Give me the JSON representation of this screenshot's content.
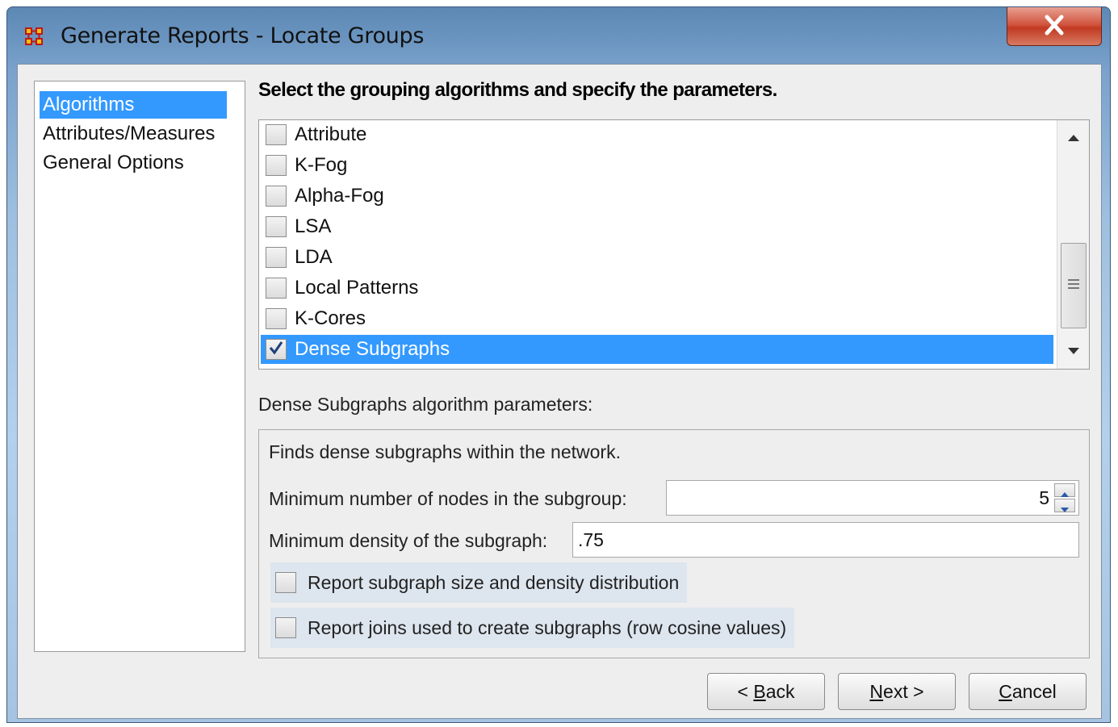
{
  "window": {
    "title": "Generate Reports - Locate Groups",
    "close_label": "X"
  },
  "nav": {
    "items": [
      {
        "label": "Algorithms",
        "selected": true
      },
      {
        "label": "Attributes/Measures",
        "selected": false
      },
      {
        "label": "General Options",
        "selected": false
      }
    ]
  },
  "algorithms": {
    "heading": "Select the grouping algorithms and specify the parameters.",
    "items": [
      {
        "label": "Attribute",
        "checked": false,
        "selected": false
      },
      {
        "label": "K-Fog",
        "checked": false,
        "selected": false
      },
      {
        "label": "Alpha-Fog",
        "checked": false,
        "selected": false
      },
      {
        "label": "LSA",
        "checked": false,
        "selected": false
      },
      {
        "label": "LDA",
        "checked": false,
        "selected": false
      },
      {
        "label": "Local Patterns",
        "checked": false,
        "selected": false
      },
      {
        "label": "K-Cores",
        "checked": false,
        "selected": false
      },
      {
        "label": "Dense Subgraphs",
        "checked": true,
        "selected": true
      }
    ]
  },
  "params": {
    "title": "Dense Subgraphs algorithm parameters:",
    "description": "Finds dense subgraphs within the network.",
    "min_nodes_label": "Minimum number of nodes in the subgroup:",
    "min_nodes_value": "5",
    "min_density_label": "Minimum density of the subgraph:",
    "min_density_value": ".75",
    "report_distribution_label": "Report subgraph size and density distribution",
    "report_distribution_checked": false,
    "report_joins_label": "Report joins used to create subgraphs (row cosine values)",
    "report_joins_checked": false
  },
  "buttons": {
    "back": {
      "prefix": "< ",
      "mnemonic": "B",
      "rest": "ack"
    },
    "next": {
      "mnemonic": "N",
      "rest": "ext >"
    },
    "cancel": {
      "mnemonic": "C",
      "rest": "ancel"
    }
  },
  "colors": {
    "selection": "#3399ff",
    "close_button": "#c9452d"
  }
}
